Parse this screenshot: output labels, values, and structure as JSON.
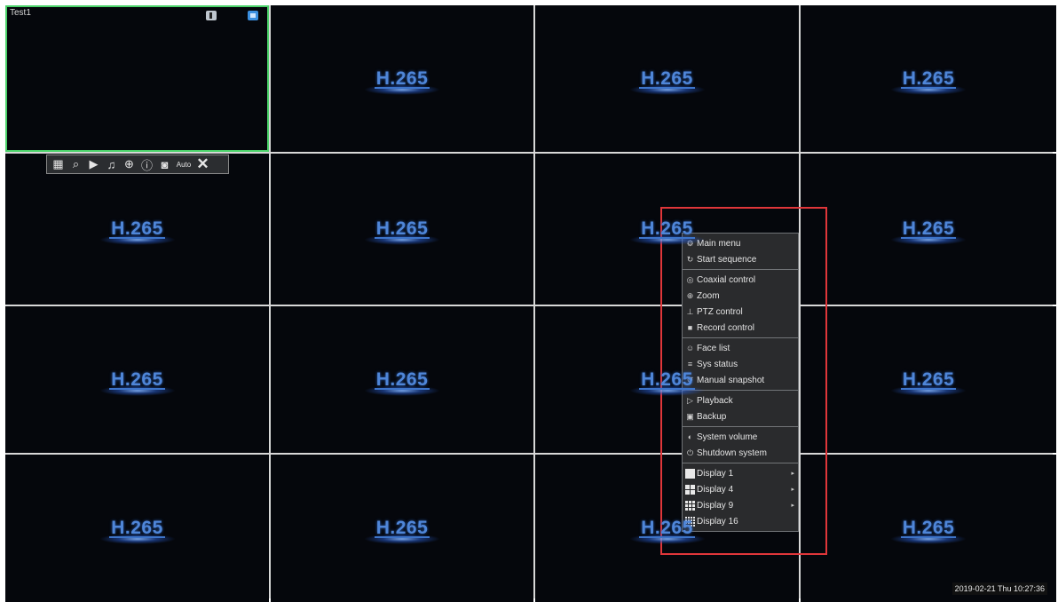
{
  "channel_1": {
    "title": "Test1"
  },
  "logo_text": "H.265",
  "toolbar": {
    "auto_label": "Auto"
  },
  "context_menu": {
    "sections": [
      [
        {
          "label": "Main menu",
          "icon": "settings-icon"
        },
        {
          "label": "Start sequence",
          "icon": "cycle-icon"
        }
      ],
      [
        {
          "label": "Coaxial control",
          "icon": "coaxial-icon"
        },
        {
          "label": "Zoom",
          "icon": "zoom-icon"
        },
        {
          "label": "PTZ control",
          "icon": "ptz-icon"
        },
        {
          "label": "Record control",
          "icon": "record-icon"
        }
      ],
      [
        {
          "label": "Face list",
          "icon": "face-icon"
        },
        {
          "label": "Sys status",
          "icon": "status-icon"
        },
        {
          "label": "Manual snapshot",
          "icon": "snapshot-icon"
        }
      ],
      [
        {
          "label": "Playback",
          "icon": "playback-icon"
        },
        {
          "label": "Backup",
          "icon": "backup-icon"
        }
      ],
      [
        {
          "label": "System volume",
          "icon": "volume-icon"
        },
        {
          "label": "Shutdown system",
          "icon": "power-icon"
        }
      ],
      [
        {
          "label": "Display 1",
          "icon": "layout-1-icon",
          "submenu": true
        },
        {
          "label": "Display 4",
          "icon": "layout-4-icon",
          "submenu": true
        },
        {
          "label": "Display 9",
          "icon": "layout-9-icon",
          "submenu": true
        },
        {
          "label": "Display 16",
          "icon": "layout-16-icon",
          "submenu": false
        }
      ]
    ]
  },
  "status": {
    "datetime": "2019-02-21 Thu 10:27:36"
  },
  "colors": {
    "highlight": "#e0363a",
    "selected_border": "#4bd26a",
    "logo": "#4f86d8"
  }
}
